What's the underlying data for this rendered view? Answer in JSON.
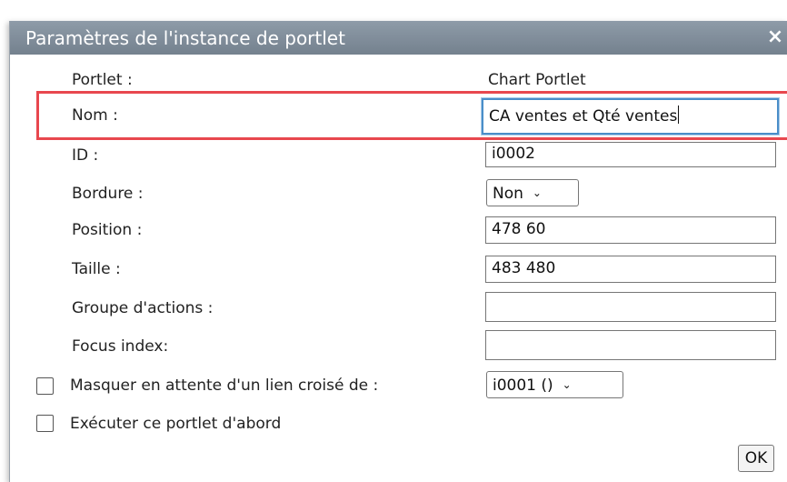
{
  "dialog": {
    "title": "Paramètres de l'instance de portlet",
    "close_glyph": "×"
  },
  "fields": {
    "portlet": {
      "label": "Portlet :",
      "value": "Chart Portlet"
    },
    "nom": {
      "label": "Nom :",
      "value": "CA ventes et Qté ventes"
    },
    "id": {
      "label": "ID :",
      "value": "i0002"
    },
    "bordure": {
      "label": "Bordure :",
      "value": "Non"
    },
    "position": {
      "label": "Position :",
      "value": "478 60"
    },
    "taille": {
      "label": "Taille :",
      "value": "483 480"
    },
    "groupe": {
      "label": "Groupe d'actions :",
      "value": ""
    },
    "focus": {
      "label": "Focus index:",
      "value": ""
    }
  },
  "options": {
    "masquer": {
      "label": "Masquer en attente d'un lien croisé de :",
      "checked": false,
      "select_value": "i0001 ()"
    },
    "executer": {
      "label": "Exécuter ce portlet d'abord",
      "checked": false
    }
  },
  "buttons": {
    "ok": "OK"
  },
  "icons": {
    "close": "close-icon",
    "dropdown": "chevron-down-icon"
  },
  "colors": {
    "titlebar": "#7f8c99",
    "highlight": "#e8474e",
    "focus_border": "#4a8ec9"
  }
}
